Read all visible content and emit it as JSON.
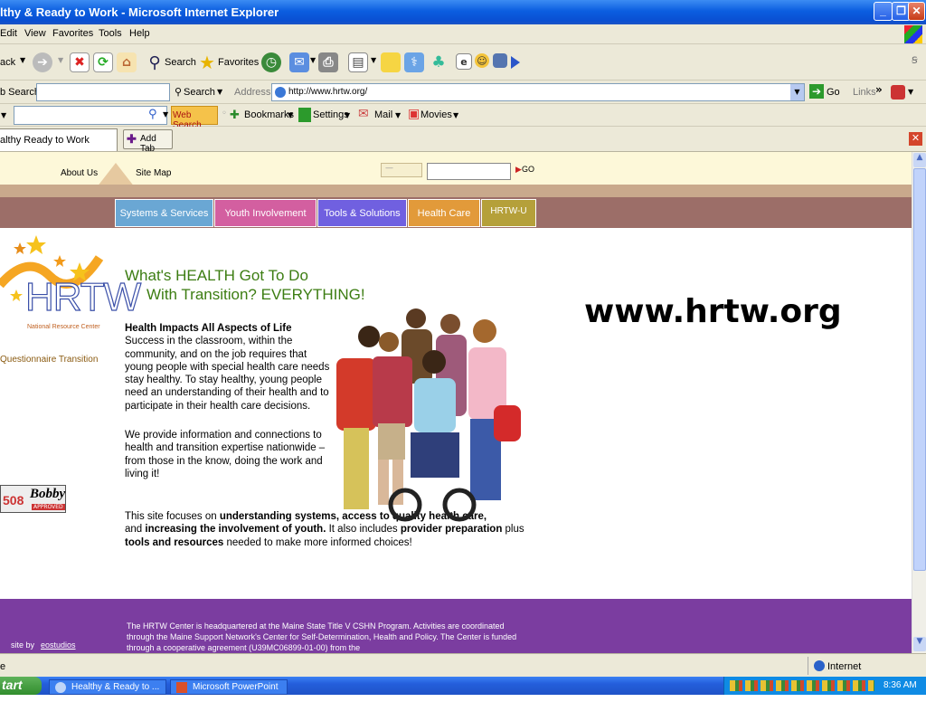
{
  "window": {
    "title": "lthy & Ready to Work - Microsoft Internet Explorer"
  },
  "menu": [
    "Edit",
    "View",
    "Favorites",
    "Tools",
    "Help"
  ],
  "toolbar": {
    "back": "ack",
    "search": "Search",
    "favorites": "Favorites"
  },
  "address_bar": {
    "search_label": "b Search",
    "search_btn": "Search",
    "address_label": "Address",
    "url": "http://www.hrtw.org/",
    "go": "Go",
    "links": "Links"
  },
  "link_bar": {
    "web_search": "Web Search",
    "bookmarks": "Bookmarks",
    "settings": "Settings",
    "mail": "Mail",
    "movies": "Movies"
  },
  "tabs": {
    "active_tab": "althy  Ready to Work",
    "add_tab": "Add Tab"
  },
  "site": {
    "top_nav": {
      "about": "About Us",
      "sitemap": "Site Map",
      "go": "GO"
    },
    "nav_tabs": [
      {
        "label": "Systems & Services",
        "color": "#6aa7d4"
      },
      {
        "label": "Youth Involvement",
        "color": "#d35fa0"
      },
      {
        "label": "Tools & Solutions",
        "color": "#7060e0"
      },
      {
        "label": "Health Care",
        "color": "#e29a3a"
      },
      {
        "label": "HRTW-U",
        "color": "#b5a03a"
      }
    ],
    "logo": {
      "text": "HRTW",
      "sub": "National Resource Center"
    },
    "sidebar_link": "Questionnaire Transition",
    "badge": {
      "num": "508",
      "name": "Bobby",
      "sub": "APPROVED"
    },
    "headline_1": "What's HEALTH Got To Do",
    "headline_2": "With Transition?  EVERYTHING!",
    "section_title": "Health Impacts All Aspects of Life",
    "para_1": "Success in the classroom, within the community, and on the job requires that young people with special health care needs stay healthy. To stay healthy, young people need an understanding of their health and to participate in their health care decisions.",
    "para_2": "We provide information and connections to health and transition expertise nationwide – from those in the know, doing the work and living it!",
    "para_3": {
      "a": "This site focuses on ",
      "b": "understanding systems, access to quality health care,",
      "c": " and ",
      "d": "increasing the involvement of youth.",
      "e": " It also includes ",
      "f": "provider preparation",
      "g": " plus ",
      "h": "tools and resources",
      "i": " needed to make more informed choices!"
    },
    "big_url": "www.hrtw.org",
    "footer": {
      "site_by": "site by ",
      "site_by_link": "eostudios",
      "text": "The HRTW Center is headquartered at the Maine State Title V CSHN Program. Activities are coordinated through the Maine Support Network's Center for Self-Determination, Health and Policy. The Center is funded through a cooperative agreement (U39MC06899-01-00) from the"
    }
  },
  "status": {
    "left": "e",
    "zone": "Internet"
  },
  "taskbar": {
    "start": "tart",
    "tasks": [
      "Healthy & Ready to ...",
      "Microsoft PowerPoint ..."
    ],
    "time": "8:36 AM"
  }
}
